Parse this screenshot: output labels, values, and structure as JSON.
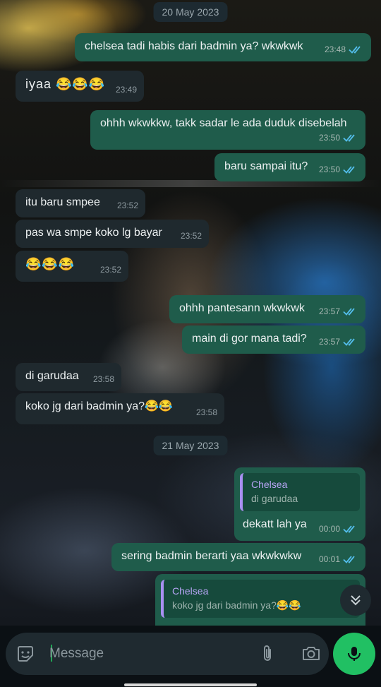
{
  "date_chips": [
    "20 May 2023",
    "21 May 2023"
  ],
  "messages": [
    {
      "dir": "out",
      "text": "chelsea tadi habis dari badmin ya? wkwkwk",
      "time": "23:48",
      "read": true
    },
    {
      "dir": "in",
      "text": "iyaa 😂😂😂",
      "time": "23:49"
    },
    {
      "dir": "out",
      "text": "ohhh wkwkkw, takk sadar le ada duduk disebelah",
      "time": "23:50",
      "read": true
    },
    {
      "dir": "out",
      "text": "baru sampai itu?",
      "time": "23:50",
      "read": true
    },
    {
      "dir": "in",
      "text": "itu baru smpee",
      "time": "23:52"
    },
    {
      "dir": "in",
      "text": "pas wa smpe koko lg bayar",
      "time": "23:52"
    },
    {
      "dir": "in",
      "text": "😂😂😂",
      "time": "23:52"
    },
    {
      "dir": "out",
      "text": "ohhh pantesann wkwkwk",
      "time": "23:57",
      "read": true
    },
    {
      "dir": "out",
      "text": "main di gor mana tadi?",
      "time": "23:57",
      "read": true
    },
    {
      "dir": "in",
      "text": "di garudaa",
      "time": "23:58"
    },
    {
      "dir": "in",
      "text": "koko jg dari badmin ya?😂😂",
      "time": "23:58"
    },
    {
      "dir": "out",
      "text": "dekatt lah ya",
      "time": "00:00",
      "read": true,
      "quote": {
        "name": "Chelsea",
        "text": "di garudaa"
      }
    },
    {
      "dir": "out",
      "text": "sering badmin berarti yaa wkwkwkw",
      "time": "00:01",
      "read": true
    },
    {
      "dir": "out",
      "text": "",
      "time": "",
      "quote": {
        "name": "Chelsea",
        "text": "koko jg dari badmin ya?😂😂"
      }
    }
  ],
  "composer": {
    "placeholder": "Message"
  },
  "icons": {
    "sticker": "sticker-icon",
    "attach": "paperclip-icon",
    "camera": "camera-icon",
    "mic": "microphone-icon",
    "scroll": "double-chevron-down-icon",
    "read": "double-check-icon"
  },
  "colors": {
    "outgoing_bubble": "#1f5c4b",
    "incoming_bubble": "#1f292e",
    "read_ticks": "#53bdeb",
    "mic_button": "#21c063",
    "quote_accent": "#a990f2"
  }
}
